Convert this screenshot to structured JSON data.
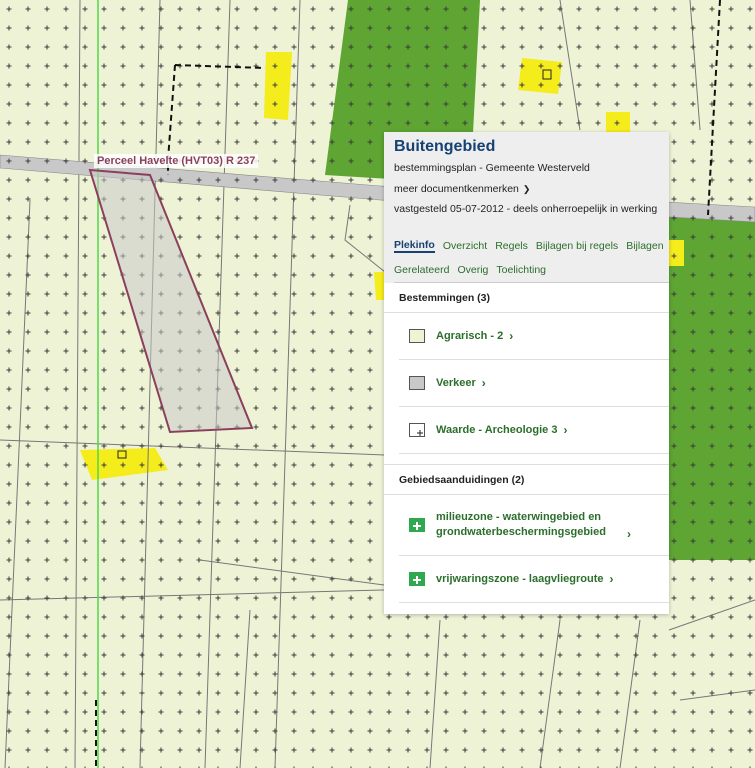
{
  "map": {
    "parcel_label": "Perceel Havelte (HVT03) R 237",
    "colors": {
      "agrarisch": "#eef3d6",
      "bos": "#5ea533",
      "verkeer": "#c8c8c8",
      "geel": "#f5ec1c",
      "perceel": "#8b3f5d",
      "raster": "#3b3b3b"
    }
  },
  "panel": {
    "title": "Buitengebied",
    "subtitle": "bestemmingsplan - Gemeente Westerveld",
    "more_label": "meer documentkenmerken",
    "status": "vastgesteld 05-07-2012 - deels onherroepelijk in werking",
    "tabs_row1": [
      "Plekinfo",
      "Overzicht",
      "Regels",
      "Bijlagen bij regels",
      "Bijlagen"
    ],
    "tabs_row2": [
      "Gerelateerd",
      "Overig",
      "Toelichting"
    ],
    "bestemmingen_title": "Bestemmingen (3)",
    "bestemmingen": [
      {
        "label": "Agrarisch - 2",
        "icon": "agrarisch-swatch"
      },
      {
        "label": "Verkeer",
        "icon": "verkeer-swatch"
      },
      {
        "label": "Waarde - Archeologie 3",
        "icon": "archeologie-swatch"
      }
    ],
    "gebieden_title": "Gebiedsaanduidingen (2)",
    "gebieden": [
      {
        "label": "milieuzone - waterwingebied en grondwaterbeschermingsgebied",
        "icon": "milieuzone-icon"
      },
      {
        "label": "vrijwaringszone - laagvliegroute",
        "icon": "vrijwaringszone-icon"
      }
    ]
  }
}
